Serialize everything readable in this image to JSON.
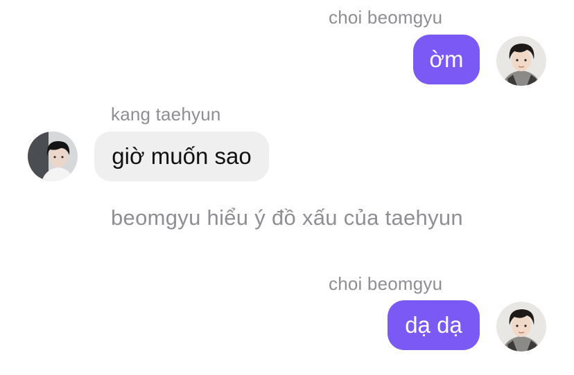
{
  "messages": [
    {
      "sender": "choi beomgyu",
      "text": "ờm",
      "side": "right",
      "avatar_icon": "beomgyu-avatar-icon"
    },
    {
      "sender": "kang taehyun",
      "text": "giờ muốn sao",
      "side": "left",
      "avatar_icon": "taehyun-avatar-icon"
    },
    {
      "narration": "beomgyu hiểu ý đồ xấu của taehyun"
    },
    {
      "sender": "choi beomgyu",
      "text": "dạ dạ",
      "side": "right",
      "avatar_icon": "beomgyu-avatar-icon"
    }
  ],
  "colors": {
    "outgoing_bubble": "#7a59f5",
    "incoming_bubble": "#efefef",
    "sender_name": "#8e8e93",
    "narration": "#8e8e93"
  }
}
